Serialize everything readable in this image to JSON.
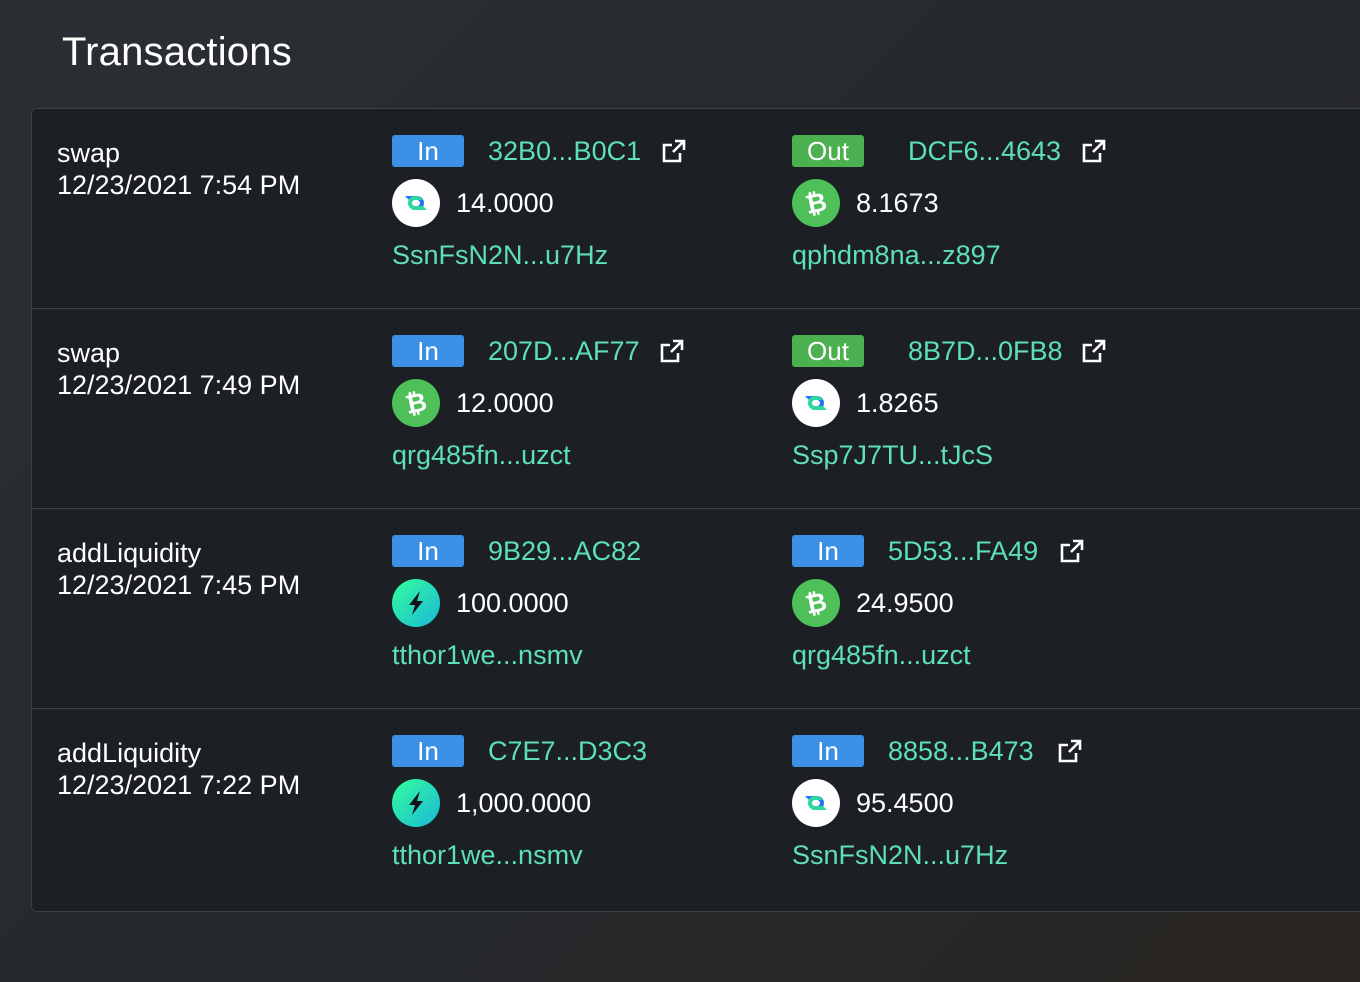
{
  "header": {
    "title": "Transactions"
  },
  "transactions": [
    {
      "type": "swap",
      "date": "12/23/2021 7:54 PM",
      "in": {
        "direction": "In",
        "hash": "32B0...B0C1",
        "coin": "decred-icon",
        "amount": "14.0000",
        "address": "SsnFsN2N...u7Hz"
      },
      "out": {
        "direction": "Out",
        "hash": "DCF6...4643",
        "coin": "bitcoin-cash-icon",
        "amount": "8.1673",
        "address": "qphdm8na...z897"
      }
    },
    {
      "type": "swap",
      "date": "12/23/2021 7:49 PM",
      "in": {
        "direction": "In",
        "hash": "207D...AF77",
        "coin": "bitcoin-cash-icon",
        "amount": "12.0000",
        "address": "qrg485fn...uzct"
      },
      "out": {
        "direction": "Out",
        "hash": "8B7D...0FB8",
        "coin": "decred-icon",
        "amount": "1.8265",
        "address": "Ssp7J7TU...tJcS"
      }
    },
    {
      "type": "addLiquidity",
      "date": "12/23/2021 7:45 PM",
      "in": {
        "direction": "In",
        "hash": "9B29...AC82",
        "coin": "rune-icon",
        "amount": "100.0000",
        "address": "tthor1we...nsmv"
      },
      "out": {
        "direction": "In",
        "hash": "5D53...FA49",
        "coin": "bitcoin-cash-icon",
        "amount": "24.9500",
        "address": "qrg485fn...uzct"
      }
    },
    {
      "type": "addLiquidity",
      "date": "12/23/2021 7:22 PM",
      "in": {
        "direction": "In",
        "hash": "C7E7...D3C3",
        "coin": "rune-icon",
        "amount": "1,000.0000",
        "address": "tthor1we...nsmv"
      },
      "out": {
        "direction": "In",
        "hash": "8858...B473",
        "coin": "decred-icon",
        "amount": "95.4500",
        "address": "SsnFsN2N...u7Hz"
      }
    }
  ],
  "colors": {
    "accent_link": "#5de0b6",
    "badge_in": "#3b8fe6",
    "badge_out": "#4caf50",
    "card_bg": "#1c1f23"
  }
}
